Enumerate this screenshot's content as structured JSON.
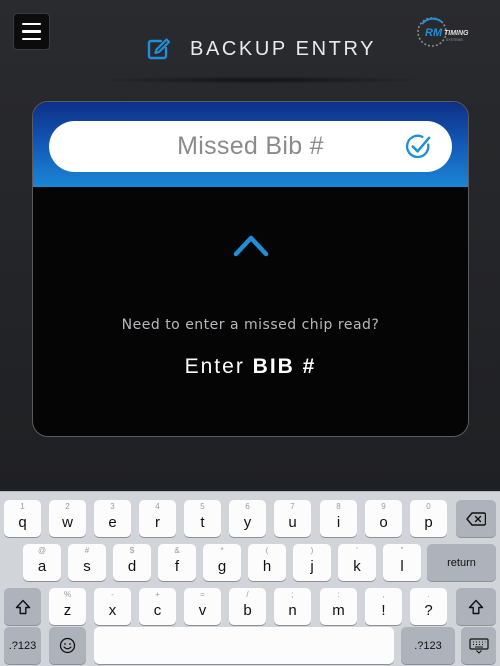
{
  "header": {
    "title": "BACKUP ENTRY",
    "logo_text_bold": "RM",
    "logo_text": "TIMING",
    "logo_sub": "SYSTEMS"
  },
  "card": {
    "input_placeholder": "Missed Bib #",
    "hint": "Need to enter a missed chip read?",
    "enter_prefix": "Enter",
    "enter_bold": "BIB #"
  },
  "colors": {
    "accent": "#1e8fd8",
    "card_gradient_top": "#0e2f86",
    "card_gradient_bottom": "#1a86d6"
  },
  "keyboard": {
    "row1": [
      {
        "main": "q",
        "sub": "1"
      },
      {
        "main": "w",
        "sub": "2"
      },
      {
        "main": "e",
        "sub": "3"
      },
      {
        "main": "r",
        "sub": "4"
      },
      {
        "main": "t",
        "sub": "5"
      },
      {
        "main": "y",
        "sub": "6"
      },
      {
        "main": "u",
        "sub": "7"
      },
      {
        "main": "i",
        "sub": "8"
      },
      {
        "main": "o",
        "sub": "9"
      },
      {
        "main": "p",
        "sub": "0"
      }
    ],
    "row2": [
      {
        "main": "a",
        "sub": "@"
      },
      {
        "main": "s",
        "sub": "#"
      },
      {
        "main": "d",
        "sub": "$"
      },
      {
        "main": "f",
        "sub": "&"
      },
      {
        "main": "g",
        "sub": "*"
      },
      {
        "main": "h",
        "sub": "("
      },
      {
        "main": "j",
        "sub": ")"
      },
      {
        "main": "k",
        "sub": "'"
      },
      {
        "main": "l",
        "sub": "\""
      }
    ],
    "row3": [
      {
        "main": "z",
        "sub": "%"
      },
      {
        "main": "x",
        "sub": "-"
      },
      {
        "main": "c",
        "sub": "+"
      },
      {
        "main": "v",
        "sub": "="
      },
      {
        "main": "b",
        "sub": "/"
      },
      {
        "main": "n",
        "sub": ";"
      },
      {
        "main": "m",
        "sub": ":"
      },
      {
        "main": "!",
        "sub": ","
      },
      {
        "main": "?",
        "sub": "."
      }
    ],
    "return_label": "return",
    "numbers_label": ".?123",
    "backspace_icon": "backspace-icon",
    "shift_icon": "shift-icon",
    "emoji_icon": "emoji-icon",
    "keyboard_dismiss_icon": "keyboard-icon"
  }
}
